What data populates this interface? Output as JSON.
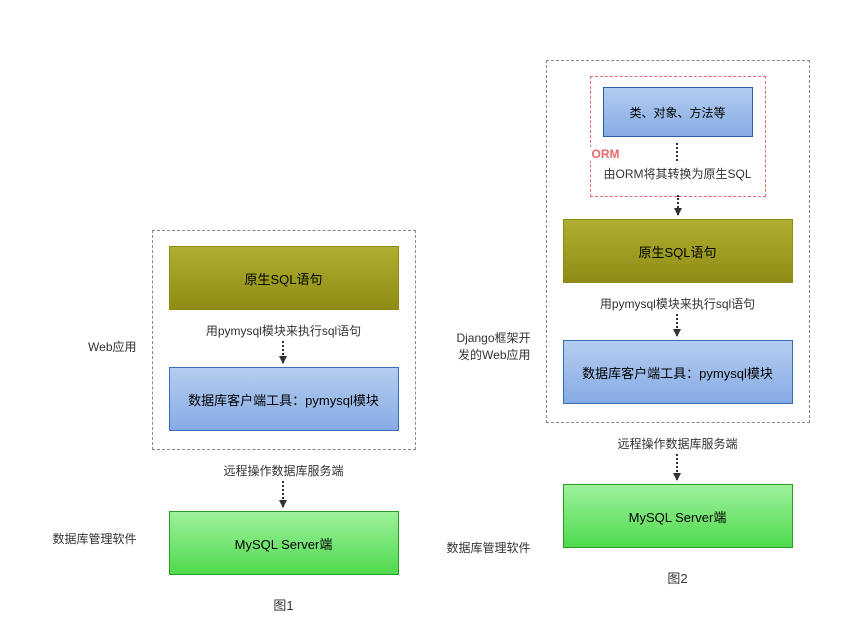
{
  "diagram1": {
    "sideLabel1": "Web应用",
    "sideLabel2": "数据库管理软件",
    "sqlBox": "原生SQL语句",
    "arrow1": "用pymysql模块来执行sql语句",
    "clientBox": "数据库客户端工具：pymysql模块",
    "arrow2": "远程操作数据库服务端",
    "serverBox": "MySQL Server端",
    "caption": "图1"
  },
  "diagram2": {
    "sideLabel1": "Django框架开发的Web应用",
    "sideLabel2": "数据库管理软件",
    "ormLabel": "ORM",
    "classBox": "类、对象、方法等",
    "ormArrow": "由ORM将其转换为原生SQL",
    "sqlBox": "原生SQL语句",
    "arrow1": "用pymysql模块来执行sql语句",
    "clientBox": "数据库客户端工具：pymysql模块",
    "arrow2": "远程操作数据库服务端",
    "serverBox": "MySQL Server端",
    "caption": "图2"
  }
}
